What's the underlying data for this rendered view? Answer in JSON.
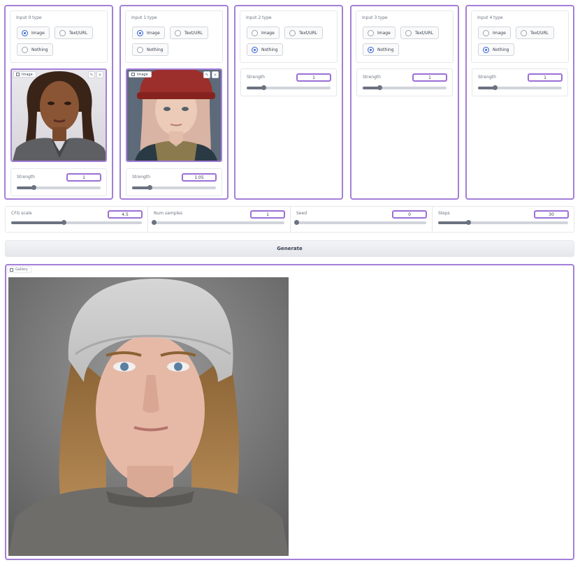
{
  "inputs": [
    {
      "type_label": "Input 0 type",
      "options": [
        "Image",
        "Text/URL",
        "Nothing"
      ],
      "selected": "Image",
      "image_label": "Image",
      "strength_label": "Strength",
      "strength_value": "1",
      "strength_fraction": 0.2
    },
    {
      "type_label": "Input 1 type",
      "options": [
        "Image",
        "Text/URL",
        "Nothing"
      ],
      "selected": "Image",
      "image_label": "Image",
      "strength_label": "Strength",
      "strength_value": "1.05",
      "strength_fraction": 0.21
    },
    {
      "type_label": "Input 2 type",
      "options": [
        "Image",
        "Text/URL",
        "Nothing"
      ],
      "selected": "Nothing",
      "strength_label": "Strength",
      "strength_value": "1",
      "strength_fraction": 0.2
    },
    {
      "type_label": "Input 3 type",
      "options": [
        "Image",
        "Text/URL",
        "Nothing"
      ],
      "selected": "Nothing",
      "strength_label": "Strength",
      "strength_value": "1",
      "strength_fraction": 0.2
    },
    {
      "type_label": "Input 4 type",
      "options": [
        "Image",
        "Text/URL",
        "Nothing"
      ],
      "selected": "Nothing",
      "strength_label": "Strength",
      "strength_value": "1",
      "strength_fraction": 0.2
    }
  ],
  "params": [
    {
      "label": "CFG scale",
      "value": "4.5",
      "fraction": 0.4
    },
    {
      "label": "Num samples",
      "value": "1",
      "fraction": 0.0
    },
    {
      "label": "Seed",
      "value": "0",
      "fraction": 0.0
    },
    {
      "label": "Steps",
      "value": "30",
      "fraction": 0.23
    }
  ],
  "generate_label": "Generate",
  "gallery_label": "Gallery",
  "icons": {
    "image_tag": "image-icon",
    "edit": "edit-icon",
    "close": "close-icon",
    "gallery_tag": "gallery-icon"
  },
  "colors": {
    "accent_border": "#a47fd8",
    "radio_selected": "#3b66d6"
  }
}
